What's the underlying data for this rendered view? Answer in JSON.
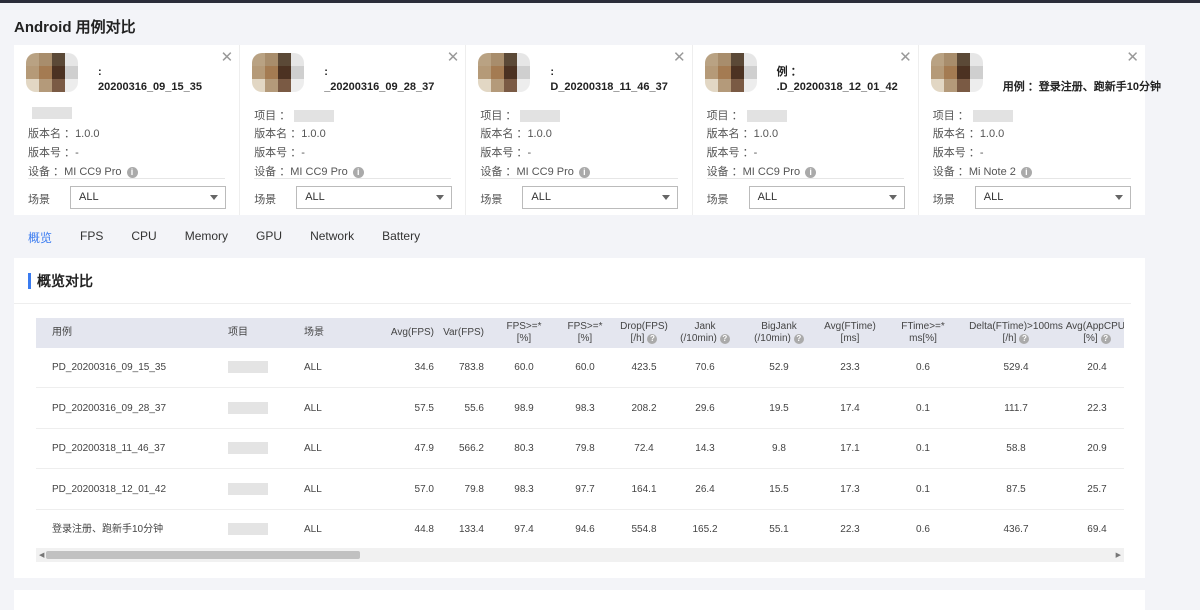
{
  "page_title": "Android 用例对比",
  "cards": [
    {
      "title": "20200316_09_15_35",
      "title_prefix": ":",
      "project_label": "",
      "version_name_label": "版本名 ：",
      "version_name": "1.0.0",
      "version_code_label": "版本号 ：",
      "version_code": "-",
      "device_label": "设备 ：",
      "device": "MI CC9 Pro",
      "scene_label": "场景",
      "scene": "ALL"
    },
    {
      "title": "_20200316_09_28_37",
      "title_prefix": ":",
      "project_label": "项目 ：",
      "version_name_label": "版本名 ：",
      "version_name": "1.0.0",
      "version_code_label": "版本号 ：",
      "version_code": "-",
      "device_label": "设备 ：",
      "device": "MI CC9 Pro",
      "scene_label": "场景",
      "scene": "ALL"
    },
    {
      "title": "D_20200318_11_46_37",
      "title_prefix": ":",
      "project_label": "项目 ：",
      "version_name_label": "版本名 ：",
      "version_name": "1.0.0",
      "version_code_label": "版本号 ：",
      "version_code": "-",
      "device_label": "设备 ：",
      "device": "MI CC9 Pro",
      "scene_label": "场景",
      "scene": "ALL"
    },
    {
      "title": ".D_20200318_12_01_42",
      "title_prefix": "例 ：",
      "project_label": "项目 ：",
      "version_name_label": "版本名 ：",
      "version_name": "1.0.0",
      "version_code_label": "版本号 ：",
      "version_code": "-",
      "device_label": "设备 ：",
      "device": "MI CC9 Pro",
      "scene_label": "场景",
      "scene": "ALL"
    },
    {
      "title": "用例 ：登录注册、跑新手10分钟",
      "title_prefix": "",
      "project_label": "项目 ：",
      "version_name_label": "版本名 ：",
      "version_name": "1.0.0",
      "version_code_label": "版本号 ：",
      "version_code": "-",
      "device_label": "设备 ：",
      "device": "Mi Note 2",
      "scene_label": "场景",
      "scene": "ALL"
    }
  ],
  "tabs": [
    "概览",
    "FPS",
    "CPU",
    "Memory",
    "GPU",
    "Network",
    "Battery"
  ],
  "active_tab": "概览",
  "panel_title": "概览对比",
  "table": {
    "headers": [
      {
        "l1": "用例",
        "l2": ""
      },
      {
        "l1": "项目",
        "l2": ""
      },
      {
        "l1": "场景",
        "l2": ""
      },
      {
        "l1": "Avg(FPS)",
        "l2": ""
      },
      {
        "l1": "Var(FPS)",
        "l2": ""
      },
      {
        "l1": "FPS>=*",
        "l2": "[%]"
      },
      {
        "l1": "FPS>=*",
        "l2": "[%]"
      },
      {
        "l1": "Drop(FPS)",
        "l2": "[/h]",
        "help": true
      },
      {
        "l1": "Jank",
        "l2": "(/10min)",
        "help": true
      },
      {
        "l1": "BigJank",
        "l2": "(/10min)",
        "help": true
      },
      {
        "l1": "Avg(FTime)",
        "l2": "[ms]"
      },
      {
        "l1": "FTime>=*",
        "l2": "ms[%]"
      },
      {
        "l1": "Delta(FTime)>100ms",
        "l2": "[/h]",
        "help": true
      },
      {
        "l1": "Avg(AppCPU)",
        "l2": "[%]",
        "help": true
      }
    ],
    "rows": [
      [
        "PD_20200316_09_15_35",
        "",
        "ALL",
        "34.6",
        "783.8",
        "60.0",
        "60.0",
        "423.5",
        "70.6",
        "52.9",
        "23.3",
        "0.6",
        "529.4",
        "20.4"
      ],
      [
        "PD_20200316_09_28_37",
        "",
        "ALL",
        "57.5",
        "55.6",
        "98.9",
        "98.3",
        "208.2",
        "29.6",
        "19.5",
        "17.4",
        "0.1",
        "111.7",
        "22.3"
      ],
      [
        "PD_20200318_11_46_37",
        "",
        "ALL",
        "47.9",
        "566.2",
        "80.3",
        "79.8",
        "72.4",
        "14.3",
        "9.8",
        "17.1",
        "0.1",
        "58.8",
        "20.9"
      ],
      [
        "PD_20200318_12_01_42",
        "",
        "ALL",
        "57.0",
        "79.8",
        "98.3",
        "97.7",
        "164.1",
        "26.4",
        "15.5",
        "17.3",
        "0.1",
        "87.5",
        "25.7"
      ],
      [
        "登录注册、跑新手10分钟",
        "",
        "ALL",
        "44.8",
        "133.4",
        "97.4",
        "94.6",
        "554.8",
        "165.2",
        "55.1",
        "22.3",
        "0.6",
        "436.7",
        "69.4"
      ]
    ]
  },
  "colors": {
    "accent": "#3a7bf0",
    "header_bg": "#e4e6ef",
    "topbar": "#2b2d3a"
  }
}
